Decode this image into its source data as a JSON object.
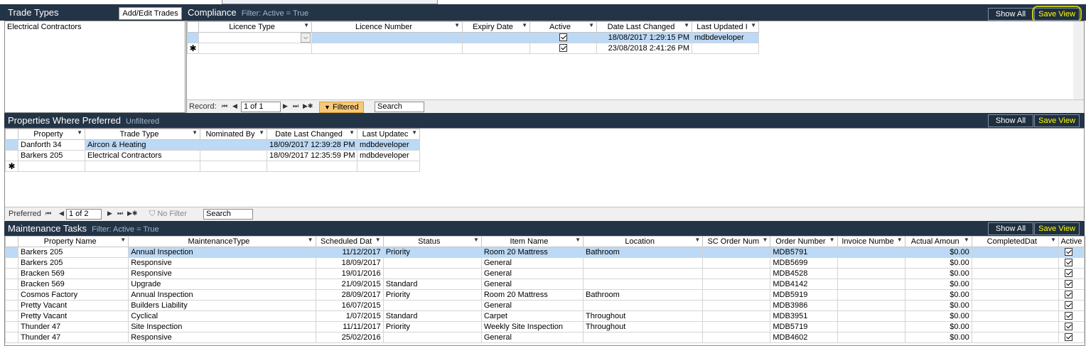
{
  "colors": {
    "panel_header": "#243447",
    "selected_row": "#bcd9f5",
    "save_view": "#ffff00",
    "filtered_badge": "#f5c97a"
  },
  "trade_types": {
    "title": "Trade Types",
    "add_edit_label": "Add/Edit Trades",
    "items": [
      "Electrical Contractors"
    ]
  },
  "compliance": {
    "title": "Compliance",
    "filter_text": "Filter: Active = True",
    "show_all_label": "Show All",
    "save_view_label": "Save View",
    "columns": [
      "Licence Type",
      "Licence Number",
      "Expiry Date",
      "Active",
      "Date Last Changed",
      "Last Updated I"
    ],
    "rows": [
      {
        "licence_type": "",
        "licence_number": "",
        "expiry": "",
        "active": true,
        "changed": "18/08/2017 1:29:15 PM",
        "updated_by": "mdbdeveloper"
      },
      {
        "licence_type": "",
        "licence_number": "",
        "expiry": "",
        "active": true,
        "changed": "23/08/2018 2:41:26 PM",
        "updated_by": ""
      }
    ],
    "nav": {
      "record_label": "Record:",
      "position": "1 of 1",
      "filtered_label": "Filtered",
      "search_label": "Search"
    }
  },
  "preferred": {
    "title": "Properties Where Preferred",
    "filter_text": "Unfiltered",
    "show_all_label": "Show All",
    "save_view_label": "Save View",
    "columns": [
      "Property",
      "Trade Type",
      "Nominated By",
      "Date Last Changed",
      "Last Updatec"
    ],
    "rows": [
      {
        "property": "Danforth 34",
        "trade_type": "Aircon & Heating",
        "nominated_by": "",
        "changed": "18/09/2017 12:39:28 PM",
        "updated_by": "mdbdeveloper"
      },
      {
        "property": "Barkers 205",
        "trade_type": "Electrical Contractors",
        "nominated_by": "",
        "changed": "18/09/2017 12:35:59 PM",
        "updated_by": "mdbdeveloper"
      }
    ],
    "nav": {
      "record_label": "Preferred",
      "position": "1 of 2",
      "no_filter_label": "No Filter",
      "search_label": "Search"
    }
  },
  "maintenance": {
    "title": "Maintenance Tasks",
    "filter_text": "Filter: Active = True",
    "show_all_label": "Show All",
    "save_view_label": "Save View",
    "columns": [
      "Property Name",
      "MaintenanceType",
      "Scheduled Dat",
      "Status",
      "Item Name",
      "Location",
      "SC Order Num",
      "Order Number",
      "Invoice Numbe",
      "Actual Amoun",
      "CompletedDat",
      "Active"
    ],
    "rows": [
      {
        "property": "Barkers 205",
        "type": "Annual Inspection",
        "scheduled": "11/12/2017",
        "status": "Priority",
        "item": "Room 20 Mattress",
        "location": "Bathroom",
        "sc_order": "",
        "order": "MDB5791",
        "invoice": "",
        "amount": "$0.00",
        "completed": "",
        "active": true
      },
      {
        "property": "Barkers 205",
        "type": "Responsive",
        "scheduled": "18/09/2017",
        "status": "",
        "item": "General",
        "location": "",
        "sc_order": "",
        "order": "MDB5699",
        "invoice": "",
        "amount": "$0.00",
        "completed": "",
        "active": true
      },
      {
        "property": "Bracken 569",
        "type": "Responsive",
        "scheduled": "19/01/2016",
        "status": "",
        "item": "General",
        "location": "",
        "sc_order": "",
        "order": "MDB4528",
        "invoice": "",
        "amount": "$0.00",
        "completed": "",
        "active": true
      },
      {
        "property": "Bracken 569",
        "type": "Upgrade",
        "scheduled": "21/09/2015",
        "status": "Standard",
        "item": "General",
        "location": "",
        "sc_order": "",
        "order": "MDB4142",
        "invoice": "",
        "amount": "$0.00",
        "completed": "",
        "active": true
      },
      {
        "property": "Cosmos Factory",
        "type": "Annual Inspection",
        "scheduled": "28/09/2017",
        "status": "Priority",
        "item": "Room 20 Mattress",
        "location": "Bathroom",
        "sc_order": "",
        "order": "MDB5919",
        "invoice": "",
        "amount": "$0.00",
        "completed": "",
        "active": true
      },
      {
        "property": "Pretty Vacant",
        "type": "Builders Liability",
        "scheduled": "16/07/2015",
        "status": "",
        "item": "General",
        "location": "",
        "sc_order": "",
        "order": "MDB3986",
        "invoice": "",
        "amount": "$0.00",
        "completed": "",
        "active": true
      },
      {
        "property": "Pretty Vacant",
        "type": "Cyclical",
        "scheduled": "1/07/2015",
        "status": "Standard",
        "item": "Carpet",
        "location": "Throughout",
        "sc_order": "",
        "order": "MDB3951",
        "invoice": "",
        "amount": "$0.00",
        "completed": "",
        "active": true
      },
      {
        "property": "Thunder 47",
        "type": "Site Inspection",
        "scheduled": "11/11/2017",
        "status": "Priority",
        "item": "Weekly Site Inspection",
        "location": "Throughout",
        "sc_order": "",
        "order": "MDB5719",
        "invoice": "",
        "amount": "$0.00",
        "completed": "",
        "active": true
      },
      {
        "property": "Thunder 47",
        "type": "Responsive",
        "scheduled": "25/02/2016",
        "status": "",
        "item": "General",
        "location": "",
        "sc_order": "",
        "order": "MDB4602",
        "invoice": "",
        "amount": "$0.00",
        "completed": "",
        "active": true
      }
    ]
  }
}
